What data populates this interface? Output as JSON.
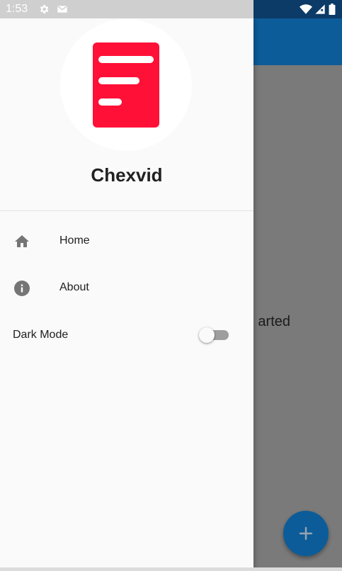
{
  "status_bar": {
    "time": "1:53",
    "left_icons": [
      "gear-icon",
      "gmail-icon"
    ],
    "right_icons": [
      "wifi-icon",
      "signal-icon",
      "battery-icon"
    ]
  },
  "drawer": {
    "logo_icon": "document-icon",
    "logo_color": "#ff1037",
    "app_name": "Chexvid",
    "menu": [
      {
        "icon": "home-icon",
        "label": "Home"
      },
      {
        "icon": "info-icon",
        "label": "About"
      }
    ],
    "dark_mode": {
      "label": "Dark Mode",
      "enabled": false
    }
  },
  "background_app": {
    "body_text_visible": "arted",
    "fab_icon": "add-icon",
    "accent_color": "#0c5c99"
  }
}
